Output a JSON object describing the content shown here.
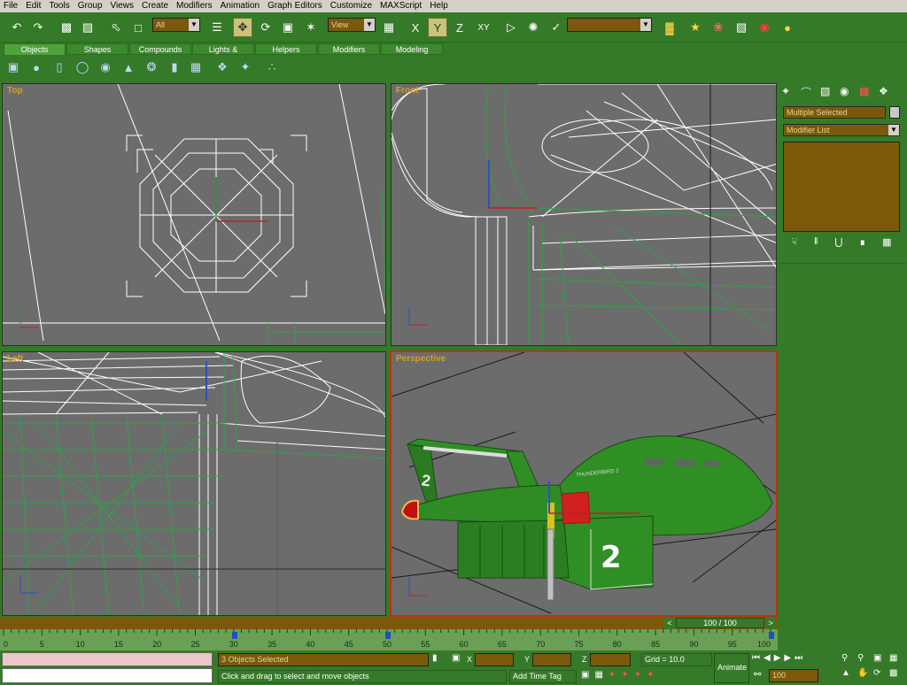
{
  "menu": [
    "File",
    "Edit",
    "Tools",
    "Group",
    "Views",
    "Create",
    "Modifiers",
    "Animation",
    "Graph Editors",
    "Customize",
    "MAXScript",
    "Help"
  ],
  "toolbar": {
    "selection_filter": "All",
    "ref_coord": "View",
    "named_selection": "",
    "constraint_labels": [
      "X",
      "Y",
      "Z",
      "XY"
    ]
  },
  "tabs": [
    "Objects",
    "Shapes",
    "Compounds",
    "Lights & Cameras",
    "Helpers",
    "Modifiers",
    "Modeling"
  ],
  "object_icons": [
    "box-icon",
    "sphere-icon",
    "cylinder-icon",
    "torus-icon",
    "teapot-icon",
    "cone-icon",
    "geosphere-icon",
    "tube-icon",
    "plane-icon",
    "pyramid-icon",
    "hedra-icon",
    "particle-icon"
  ],
  "viewports": {
    "top": "Top",
    "front": "Front",
    "left": "Left",
    "perspective": "Perspective"
  },
  "perspective_markings": {
    "fin_number": "2",
    "pod_number": "2",
    "nose_text": "THUNDERBIRD 2"
  },
  "command_panel": {
    "object_name": "Multiple Selected",
    "modifier_list": "Modifier List"
  },
  "timeline": {
    "frame": "100 / 100"
  },
  "ruler_ticks": [
    "0",
    "5",
    "10",
    "15",
    "20",
    "25",
    "30",
    "35",
    "40",
    "45",
    "50",
    "55",
    "60",
    "65",
    "70",
    "75",
    "80",
    "85",
    "90",
    "95",
    "100"
  ],
  "status": {
    "selection": "3 Objects Selected",
    "prompt": "Click and drag to select and move objects",
    "x_label": "X",
    "y_label": "Y",
    "z_label": "Z",
    "x_value": "",
    "y_value": "",
    "z_value": "",
    "grid": "Grid = 10.0",
    "add_time_tag": "Add Time Tag",
    "animate": "Animate",
    "current_frame": "100"
  },
  "colors": {
    "ui_green": "#357a28",
    "field_brown": "#7a5a0a",
    "viewport_gray": "#6c6c6c",
    "active_border": "#c03010",
    "label_gold": "#d4a020"
  }
}
